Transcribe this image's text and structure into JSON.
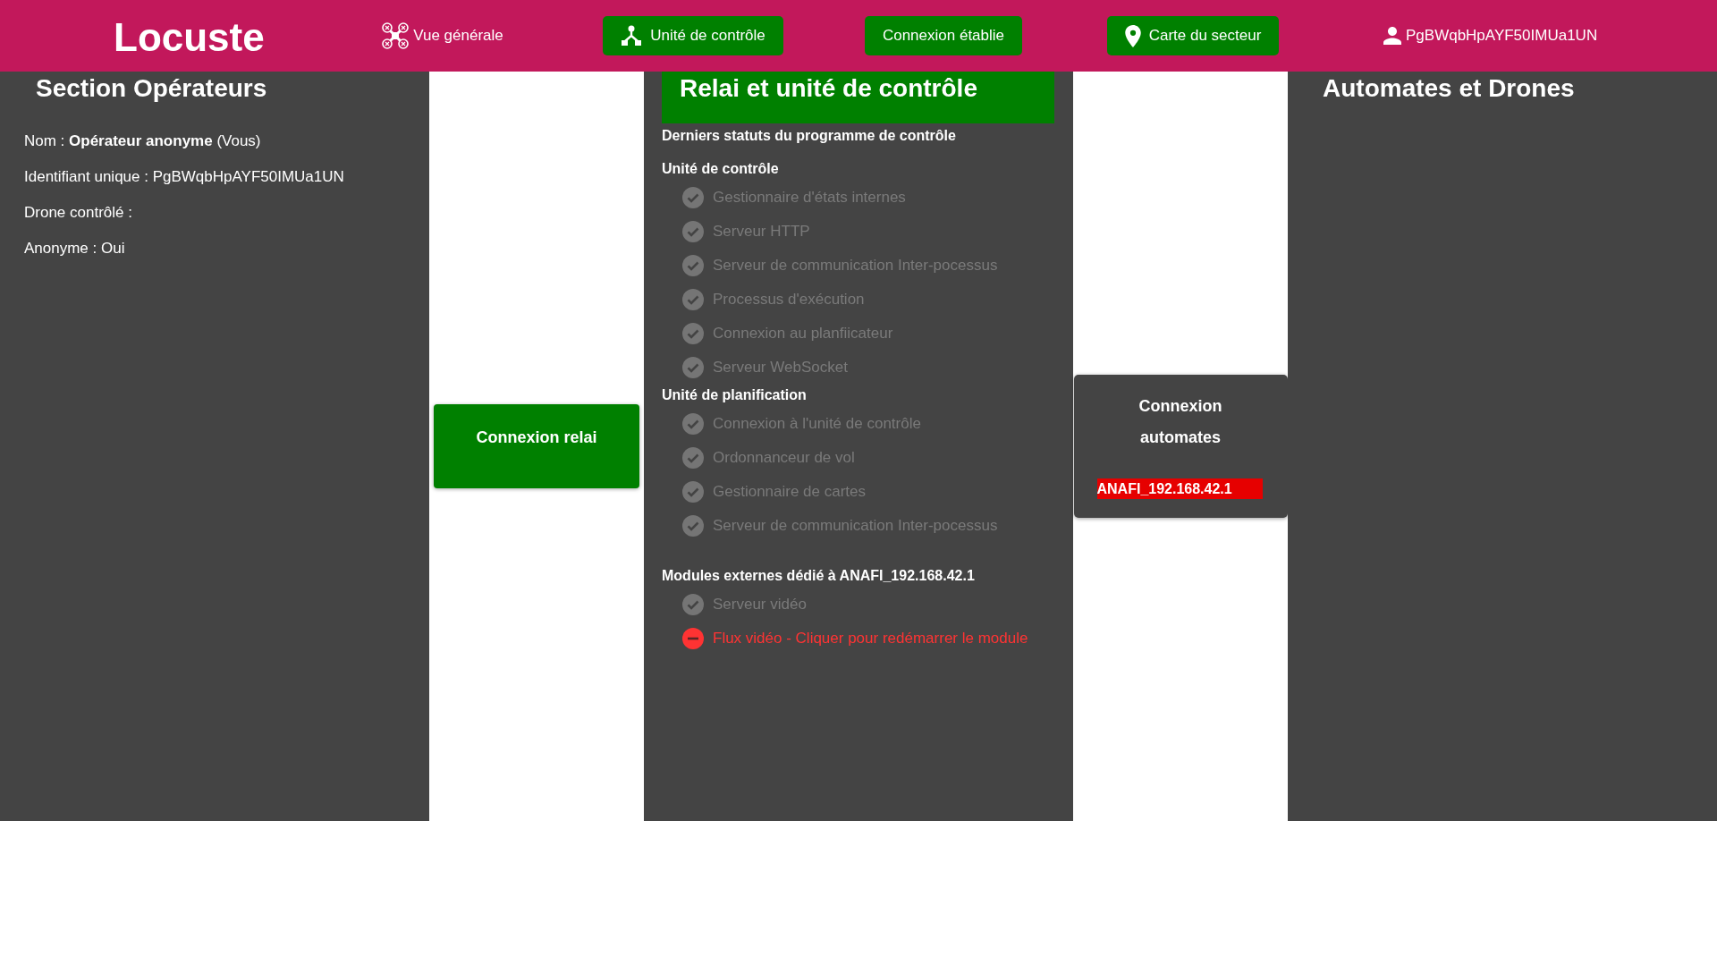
{
  "header": {
    "logo": "Locuste",
    "nav": [
      {
        "label": "Vue générale",
        "highlighted": false
      },
      {
        "label": "Unité de contrôle",
        "highlighted": true
      },
      {
        "label": "Connexion établie",
        "highlighted": true
      },
      {
        "label": "Carte du secteur",
        "highlighted": true
      }
    ],
    "user": {
      "label": "PgBWqbHpAYF50IMUa1UN"
    }
  },
  "operators": {
    "title": "Section Opérateurs",
    "fields": [
      "Nom : **Opérateur anonyme** (Vous)",
      "Identifiant unique : PgBWqbHpAYF50IMUa1UN",
      "Drone contrôlé :",
      "Anonyme : Oui"
    ]
  },
  "relay_button": {
    "label": "Connexion relai"
  },
  "control": {
    "title": "Relai et unité de contrôle",
    "subtitle": "Derniers statuts du programme de contrôle",
    "groups": [
      {
        "heading": "Unité de contrôle",
        "modules": [
          {
            "label": "Gestionnaire d'états internes",
            "ok": true
          },
          {
            "label": "Serveur HTTP",
            "ok": true
          },
          {
            "label": "Serveur de communication Inter-pocessus",
            "ok": true
          },
          {
            "label": "Processus d'exécution",
            "ok": true
          },
          {
            "label": "Connexion au planfiicateur",
            "ok": true
          },
          {
            "label": "Serveur WebSocket",
            "ok": true
          }
        ]
      },
      {
        "heading": "Unité de planification",
        "modules": [
          {
            "label": "Connexion à l'unité de contrôle",
            "ok": true
          },
          {
            "label": "Ordonnanceur de vol",
            "ok": true
          },
          {
            "label": "Gestionnaire de cartes",
            "ok": true
          },
          {
            "label": "Serveur de communication Inter-pocessus",
            "ok": true
          }
        ]
      },
      {
        "heading": "Modules externes dédié à ANAFI_192.168.42.1",
        "modules": [
          {
            "label": "Serveur vidéo",
            "ok": true
          },
          {
            "label": "Flux vidéo - Cliquer pour redémarrer le module",
            "ok": false
          }
        ]
      }
    ]
  },
  "automates": {
    "title": "Connexion automates",
    "drones": [
      {
        "label": "ANAFI_192.168.42.1",
        "connected": false
      }
    ]
  },
  "drones_panel": {
    "title": "Automates et Drones"
  }
}
